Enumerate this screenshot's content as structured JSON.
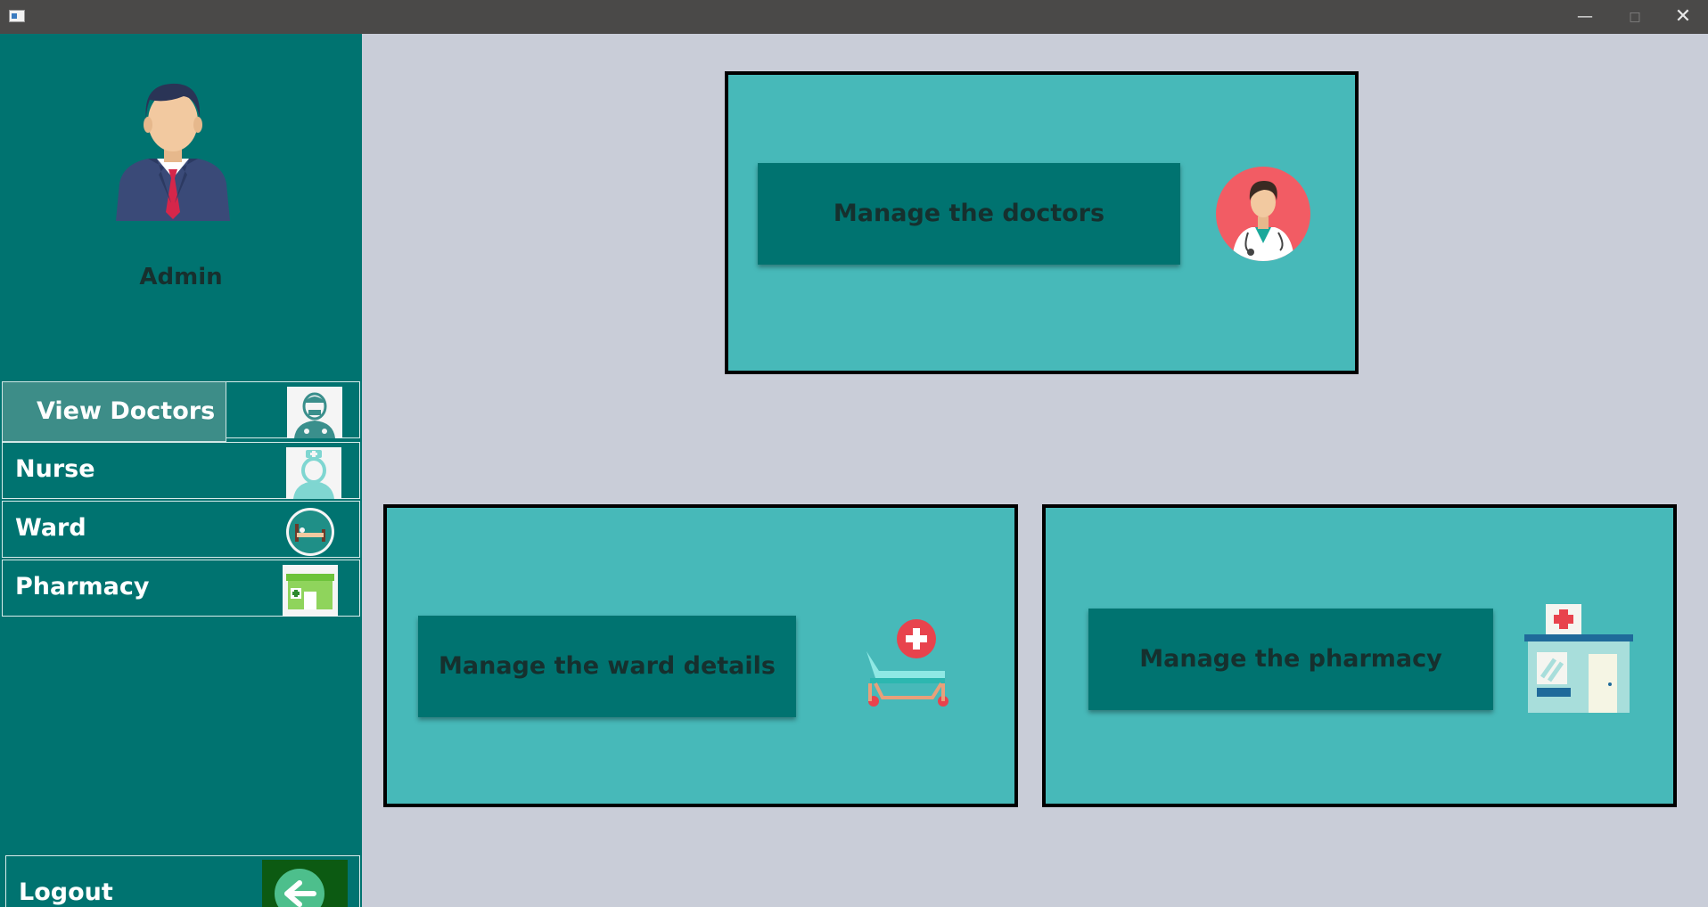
{
  "window": {
    "minimize_glyph": "—",
    "maximize_glyph": "□",
    "close_glyph": "✕"
  },
  "sidebar": {
    "user_label": "Admin",
    "items": [
      {
        "label": "View Doctors",
        "icon": "doctor-icon"
      },
      {
        "label": "Nurse",
        "icon": "nurse-icon"
      },
      {
        "label": "Ward",
        "icon": "bed-icon"
      },
      {
        "label": "Pharmacy",
        "icon": "pharmacy-store-icon"
      }
    ],
    "logout_label": "Logout",
    "logout_icon": "arrow-left-icon"
  },
  "main": {
    "cards": [
      {
        "button_label": "Manage the doctors",
        "icon": "doctor-avatar-icon"
      },
      {
        "button_label": "Manage the ward details",
        "icon": "hospital-bed-icon"
      },
      {
        "button_label": "Manage the pharmacy",
        "icon": "hospital-building-icon"
      }
    ]
  },
  "colors": {
    "sidebar_bg": "#007370",
    "content_bg": "#c9cdd8",
    "card_bg": "#47b9b9",
    "button_bg": "#007370",
    "active_item_bg": "#3d8d88",
    "logout_button_bg": "#0c5a12"
  }
}
